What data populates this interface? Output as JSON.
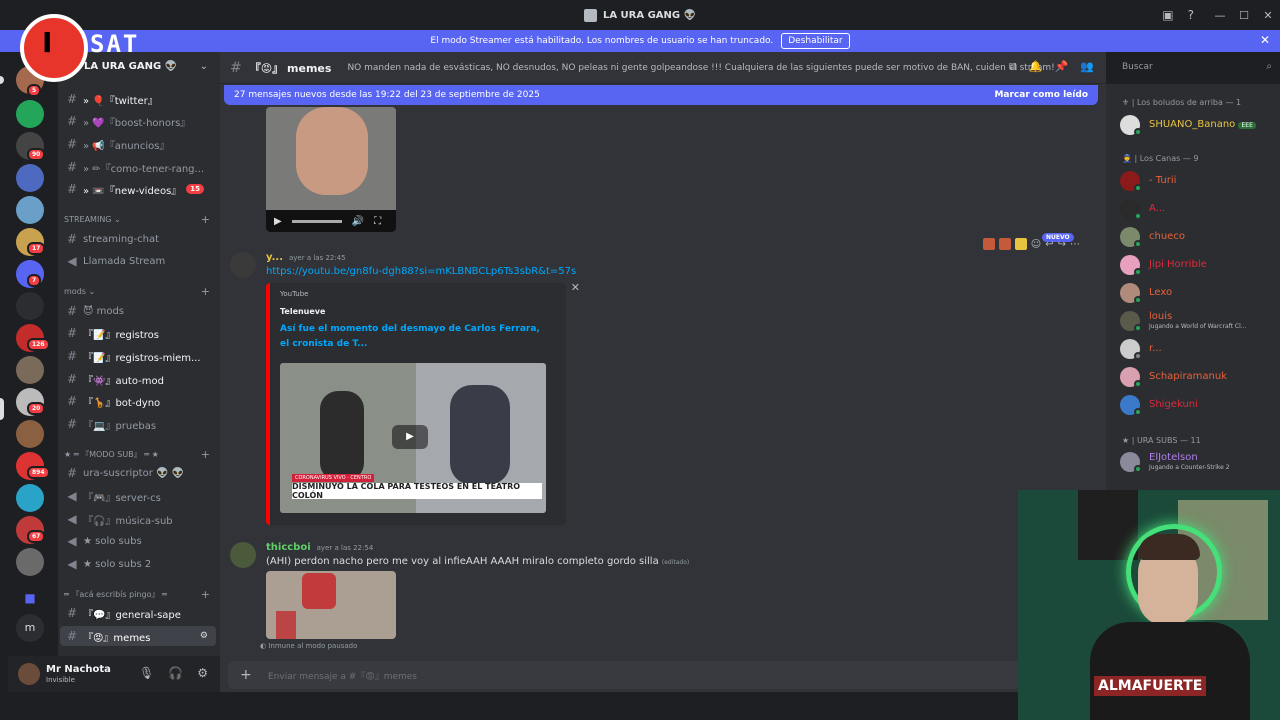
{
  "window": {
    "title": "LA URA GANG 👽"
  },
  "banner": {
    "text": "El modo Streamer está habilitado. Los nombres de usuario se han truncado.",
    "button": "Deshabilitar"
  },
  "overlay": {
    "logo_text": "SAT",
    "logo_letter": "I"
  },
  "server": {
    "name": "LA URA GANG 👽"
  },
  "guild_badges": [
    "5",
    "90",
    "17",
    "7",
    "126",
    "20",
    "894",
    "67"
  ],
  "channels": {
    "items": [
      {
        "label": "» 🎈『twitter』"
      },
      {
        "label": "» 💜『boost-honors』"
      },
      {
        "label": "» 📢『anuncios』"
      },
      {
        "label": "» ✏『como-tener-rang..."
      },
      {
        "label": "» 📼『new-videos』",
        "badge": "15"
      }
    ],
    "streaming_cat": "STREAMING",
    "streaming_chat": "streaming-chat",
    "llamada": "Llamada Stream",
    "mods_cat": "mods",
    "mods": "😈 mods",
    "registros": "『📝』registros",
    "registros_miem": "『📝』registros-miem...",
    "auto_mod": "『👾』auto-mod",
    "bot_dyno": "『🦒』bot-dyno",
    "pruebas": "『💻』pruebas",
    "sub_cat": "★ ═ 『MODO SUB』 ═ ★",
    "ura_suscriptor": "ura-suscriptor 👽 👽",
    "server_cs": "『🎮』server-cs",
    "musica_sub": "『🎧』música-sub",
    "solo_subs": "★ solo subs",
    "solo_subs2": "★ solo subs 2",
    "aca_cat": "═ 『acá escribís pingo』 ═",
    "general_sape": "『💬』general-sape",
    "memes": "『😡』memes"
  },
  "user": {
    "name": "Mr Nachota",
    "status": "Invisible"
  },
  "header": {
    "channel": "『😡』 memes",
    "topic": "NO manden nada de esvásticas, NO desnudos, NO peleas ni gente golpeandose !!! Cualquiera de las siguientes puede ser motivo de BAN, cuiden el stream!",
    "search_placeholder": "Buscar"
  },
  "new_messages": {
    "text": "27 mensajes nuevos desde las 19:22 del 23 de septiembre de 2025",
    "mark": "Marcar como leído"
  },
  "messages": [
    {
      "author": "y...",
      "time": "ayer a las 22:45",
      "link": "https://youtu.be/gn8fu-dgh88?si=mKLBNBCLp6Ts3sbR&t=57s",
      "embed": {
        "provider": "YouTube",
        "author": "Telenueve",
        "title": "Así fue el momento del desmayo de Carlos Ferrara, el cronista de T...",
        "ticker": "DISMINUYÓ LA COLA PARA TESTEOS EN EL TEATRO COLÓN",
        "tag": "CORONAVIRUS  VIVO · CENTRO"
      }
    },
    {
      "author": "thiccboi",
      "time": "ayer a las 22:54",
      "text": "(AHI) perdon nacho pero me voy al infieAAH AAAH miralo completo gordo silla",
      "edited": "(editado)"
    }
  ],
  "hover": {
    "nuevo": "NUEVO"
  },
  "pause_note": "Inmune al modo pausado",
  "composer": {
    "placeholder": "Enviar mensaje a #『😡』memes"
  },
  "members": {
    "cat1": "⚜ | Los boludos de arriba — 1",
    "cat2": "👮 | Los Canas — 9",
    "cat3": "★ | URA SUBS — 11",
    "list": [
      {
        "name": "SHUANO_Banano",
        "tag": "EEE",
        "color": "#e8c541"
      },
      {
        "name": "- Turii",
        "color": "#e8623a"
      },
      {
        "name": "A...",
        "color": "#e02a3b"
      },
      {
        "name": "chueco",
        "color": "#e8623a"
      },
      {
        "name": "Jipi Horrible",
        "color": "#e02a3b"
      },
      {
        "name": "Lexo",
        "color": "#e8623a"
      },
      {
        "name": "louis",
        "color": "#e8623a",
        "activity": "Jugando a World of Warcraft Cl..."
      },
      {
        "name": "r...",
        "color": "#e8623a"
      },
      {
        "name": "Schapiramanuk",
        "color": "#e8623a"
      },
      {
        "name": "Shigekuni",
        "color": "#e02a3b"
      },
      {
        "name": "ElJotelson",
        "color": "#b07ee8",
        "activity": "Jugando a Counter-Strike 2"
      }
    ]
  },
  "webcam": {
    "shirt_text": "ALMAFUERTE"
  },
  "colors": {
    "accent": "#5865f2",
    "online": "#23a55a",
    "dnd": "#f23f43"
  }
}
